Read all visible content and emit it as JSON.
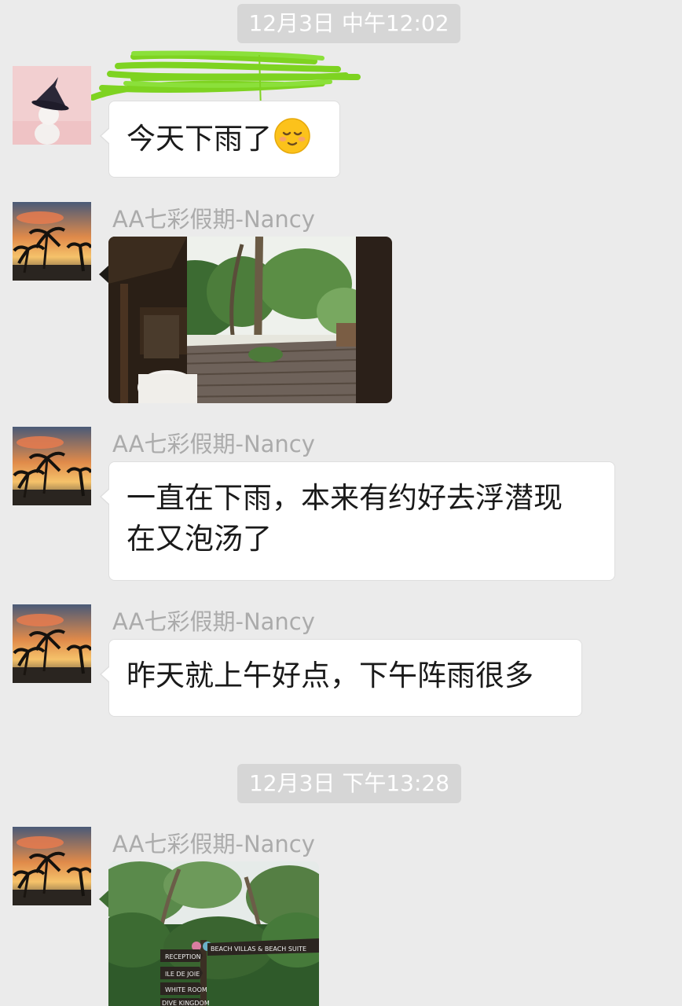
{
  "colors": {
    "background": "#ebebeb",
    "bubble": "#ffffff",
    "timestamp_bg": "#d6d6d6",
    "sender_name": "#ababab",
    "redaction": "#7ed321"
  },
  "timestamps": [
    "12月3日 中午12:02",
    "12月3日 下午13:28"
  ],
  "messages": [
    {
      "sender": "",
      "sender_redacted": true,
      "avatar": "witch-hat-cat-avatar",
      "type": "text",
      "text": "今天下雨了",
      "emoji": "relieved-face-emoji"
    },
    {
      "sender": "AA七彩假期-Nancy",
      "avatar": "sunset-palm-avatar",
      "type": "image",
      "image": "rainy-resort-deck-photo"
    },
    {
      "sender": "AA七彩假期-Nancy",
      "avatar": "sunset-palm-avatar",
      "type": "text",
      "lines": [
        "一直在下雨，本来有约好去浮潜现",
        "在又泡汤了"
      ]
    },
    {
      "sender": "AA七彩假期-Nancy",
      "avatar": "sunset-palm-avatar",
      "type": "text",
      "text": "昨天就上午好点，下午阵雨很多"
    },
    {
      "sender": "AA七彩假期-Nancy",
      "avatar": "sunset-palm-avatar",
      "type": "image",
      "image": "resort-signpost-photo",
      "signs": [
        "RECEPTION",
        "ILE DE JOIE",
        "WHITE ROOM",
        "DIVE KINGDOM",
        "BEACH VILLAS & BEACH SUITE"
      ]
    }
  ]
}
